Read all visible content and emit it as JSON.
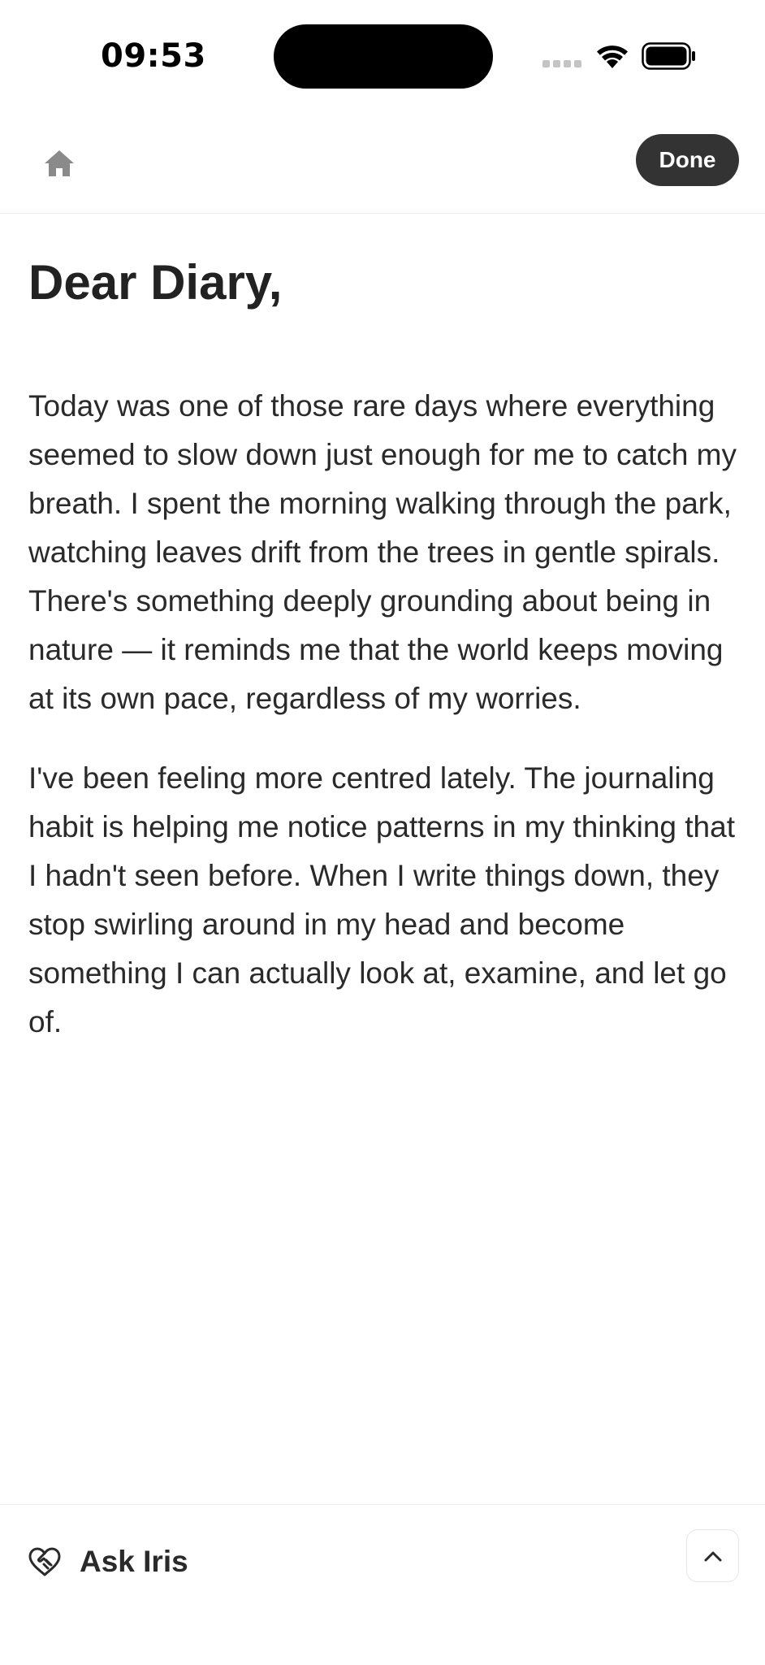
{
  "status_bar": {
    "time": "09:53",
    "icons": [
      "signal-icon",
      "wifi-icon",
      "battery-icon"
    ]
  },
  "nav": {
    "home_icon": "home-icon",
    "done_label": "Done"
  },
  "entry": {
    "title": "Dear Diary,",
    "paragraphs": [
      "Today was one of those rare days where everything seemed to slow down just enough for me to catch my breath. I spent the morning walking through the park, watching leaves drift from the trees in gentle spirals. There's something deeply grounding about being in nature — it reminds me that the world keeps moving at its own pace, regardless of my worries.",
      "I've been feeling more centred lately. The journaling habit is helping me notice patterns in my thinking that I hadn't seen before. When I write things down, they stop swirling around in my head and become something I can actually look at, examine, and let go of."
    ]
  },
  "bottom_bar": {
    "ask_label": "Ask Iris",
    "ask_icon": "heart-handshake-icon",
    "expand_icon": "chevron-up-icon"
  },
  "colors": {
    "text": "#222222",
    "done_button_bg": "#333333",
    "done_button_text": "#ffffff",
    "icon_gray": "#8a8a8a",
    "divider": "#ececec"
  }
}
